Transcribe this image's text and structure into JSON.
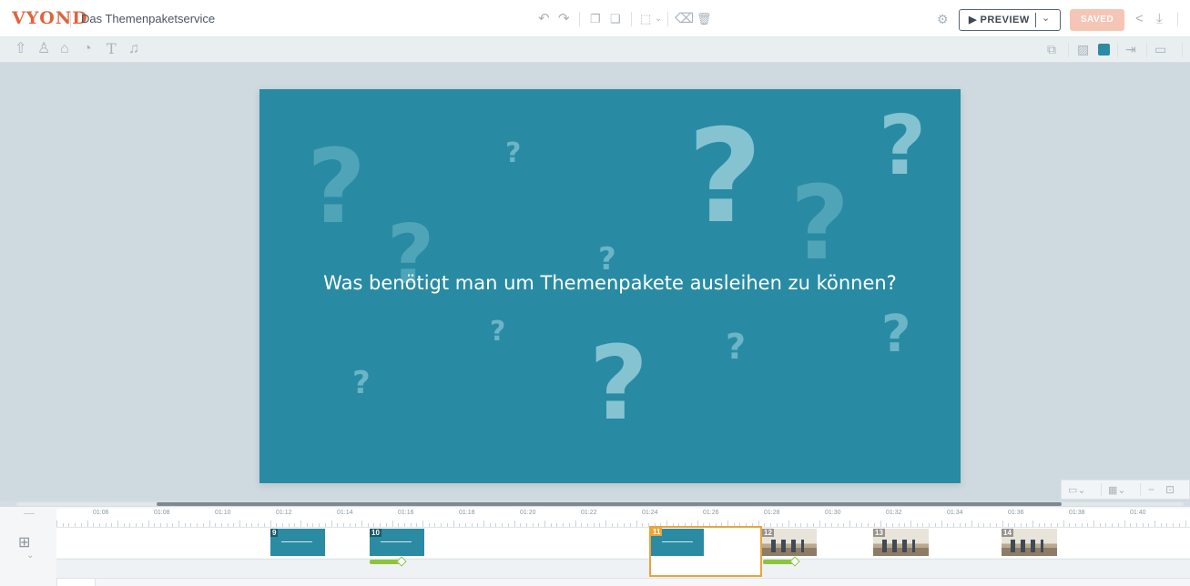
{
  "app": {
    "logo": "VYOND",
    "project_title": "Das Themenpaketservice"
  },
  "header": {
    "preview_label": "▶ PREVIEW",
    "preview_caret": "⌄",
    "saved_label": "SAVED",
    "icons": [
      "undo-icon",
      "redo-icon",
      "copy-icon",
      "paste-icon",
      "layers-icon",
      "clear-icon",
      "delete-icon",
      "settings-icon",
      "share-icon",
      "download-icon"
    ]
  },
  "toolbar": {
    "icons": [
      "upload-icon",
      "character-icon",
      "prop-icon",
      "chart-icon",
      "text-icon",
      "music-icon"
    ],
    "right_icons": [
      "swap-icon",
      "background-image-icon",
      "background-color-icon",
      "enter-effect-icon",
      "camera-icon"
    ],
    "bg_color": "#2a8ba3"
  },
  "slide": {
    "background": "#288ba3",
    "text": "Was benötigt man um Themenpakete ausleihen zu können?"
  },
  "timeline": {
    "ruler_labels": [
      "01:06",
      "01:08",
      "01:10",
      "01:12",
      "01:14",
      "01:16",
      "01:18",
      "01:20",
      "01:22",
      "01:24",
      "01:26",
      "01:28",
      "01:30",
      "01:32",
      "01:34",
      "01:36",
      "01:38",
      "01:40"
    ],
    "scenes": [
      {
        "num": "9",
        "kind": "teal"
      },
      {
        "num": "10",
        "kind": "teal"
      },
      {
        "num": "11",
        "kind": "teal"
      },
      {
        "num": "12",
        "kind": "office"
      },
      {
        "num": "13",
        "kind": "office"
      },
      {
        "num": "14",
        "kind": "office"
      }
    ]
  },
  "colors": {
    "brand": "#e0643c",
    "accent_selected": "#e8a53a",
    "transition": "#8cc43d"
  }
}
